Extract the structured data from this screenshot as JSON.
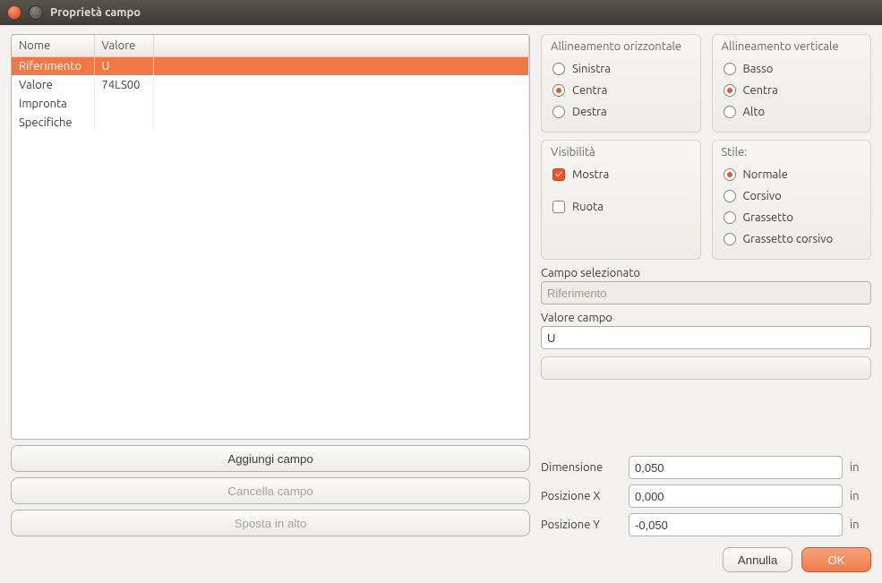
{
  "window": {
    "title": "Proprietà campo"
  },
  "table": {
    "headers": {
      "name": "Nome",
      "value": "Valore"
    },
    "rows": [
      {
        "name": "Riferimento",
        "value": "U",
        "selected": true
      },
      {
        "name": "Valore",
        "value": "74LS00"
      },
      {
        "name": "Impronta",
        "value": ""
      },
      {
        "name": "Specifiche",
        "value": ""
      }
    ]
  },
  "buttons": {
    "add": "Aggiungi campo",
    "delete": "Cancella campo",
    "moveup": "Sposta in alto"
  },
  "halign": {
    "title": "Allineamento orizzontale",
    "options": {
      "left": "Sinistra",
      "center": "Centra",
      "right": "Destra"
    },
    "selected": "center"
  },
  "valign": {
    "title": "Allineamento verticale",
    "options": {
      "bottom": "Basso",
      "center": "Centra",
      "top": "Alto"
    },
    "selected": "center"
  },
  "visibility": {
    "title": "Visibilità",
    "show": {
      "label": "Mostra",
      "checked": true
    },
    "rotate": {
      "label": "Ruota",
      "checked": false
    }
  },
  "style": {
    "title": "Stile:",
    "options": {
      "normal": "Normale",
      "italic": "Corsivo",
      "bold": "Grassetto",
      "bolditalic": "Grassetto corsivo"
    },
    "selected": "normal"
  },
  "fieldSelected": {
    "label": "Campo selezionato",
    "value": "Riferimento"
  },
  "fieldValue": {
    "label": "Valore campo",
    "value": "U"
  },
  "dims": {
    "size": {
      "label": "Dimensione",
      "value": "0,050",
      "unit": "in"
    },
    "posx": {
      "label": "Posizione X",
      "value": "0,000",
      "unit": "in"
    },
    "posy": {
      "label": "Posizione Y",
      "value": "-0,050",
      "unit": "in"
    }
  },
  "footer": {
    "cancel": "Annulla",
    "ok": "OK"
  }
}
